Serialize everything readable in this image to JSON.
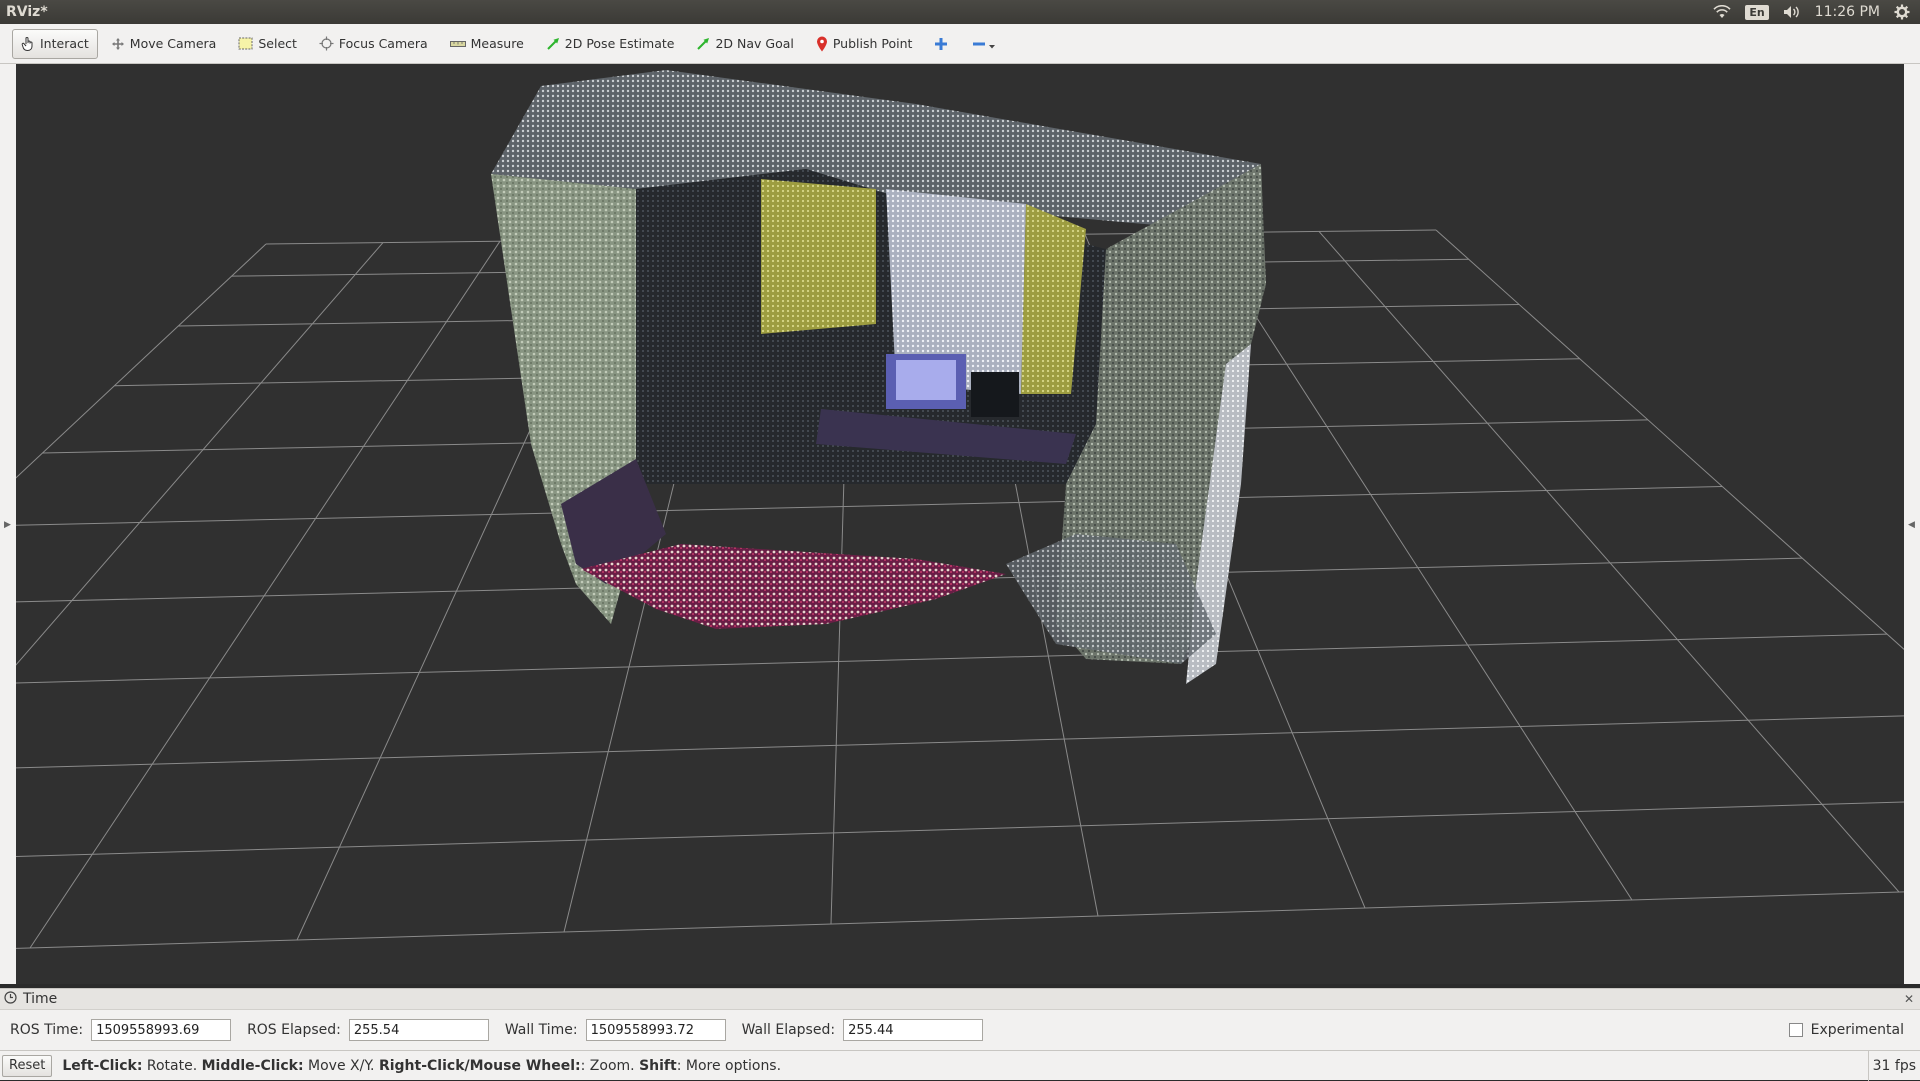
{
  "window": {
    "title": "RViz*"
  },
  "tray": {
    "language": "En",
    "time": "11:26 PM"
  },
  "toolbar": {
    "tools": [
      {
        "label": "Interact",
        "icon": "hand-pointer-icon",
        "active": true
      },
      {
        "label": "Move Camera",
        "icon": "move-camera-icon"
      },
      {
        "label": "Select",
        "icon": "select-box-icon"
      },
      {
        "label": "Focus Camera",
        "icon": "focus-camera-icon"
      },
      {
        "label": "Measure",
        "icon": "ruler-icon"
      },
      {
        "label": "2D Pose Estimate",
        "icon": "green-arrow-icon"
      },
      {
        "label": "2D Nav Goal",
        "icon": "green-arrow-icon"
      },
      {
        "label": "Publish Point",
        "icon": "map-pin-icon"
      }
    ],
    "add_tool_icon": "plus-icon",
    "remove_tool_icon": "minus-dropdown-icon"
  },
  "time_panel": {
    "header": "Time",
    "ros_time_label": "ROS Time:",
    "ros_time": "1509558993.69",
    "ros_elapsed_label": "ROS Elapsed:",
    "ros_elapsed": "255.54",
    "wall_time_label": "Wall Time:",
    "wall_time": "1509558993.72",
    "wall_elapsed_label": "Wall Elapsed:",
    "wall_elapsed": "255.44",
    "experimental_label": "Experimental"
  },
  "status": {
    "reset_label": "Reset",
    "left_click_key": "Left-Click:",
    "left_click_action": " Rotate. ",
    "middle_click_key": "Middle-Click:",
    "middle_click_action": " Move X/Y. ",
    "right_click_key": "Right-Click/Mouse Wheel:",
    "right_click_action": ": Zoom. ",
    "shift_key": "Shift",
    "shift_action": ": More options.",
    "fps": "31 fps"
  },
  "colors": {
    "viewport_bg": "#303030",
    "grid_line": "#8a8a8a",
    "toolbar_bg": "#f2f1f0",
    "titlebar_bg": "#3c3b37"
  }
}
